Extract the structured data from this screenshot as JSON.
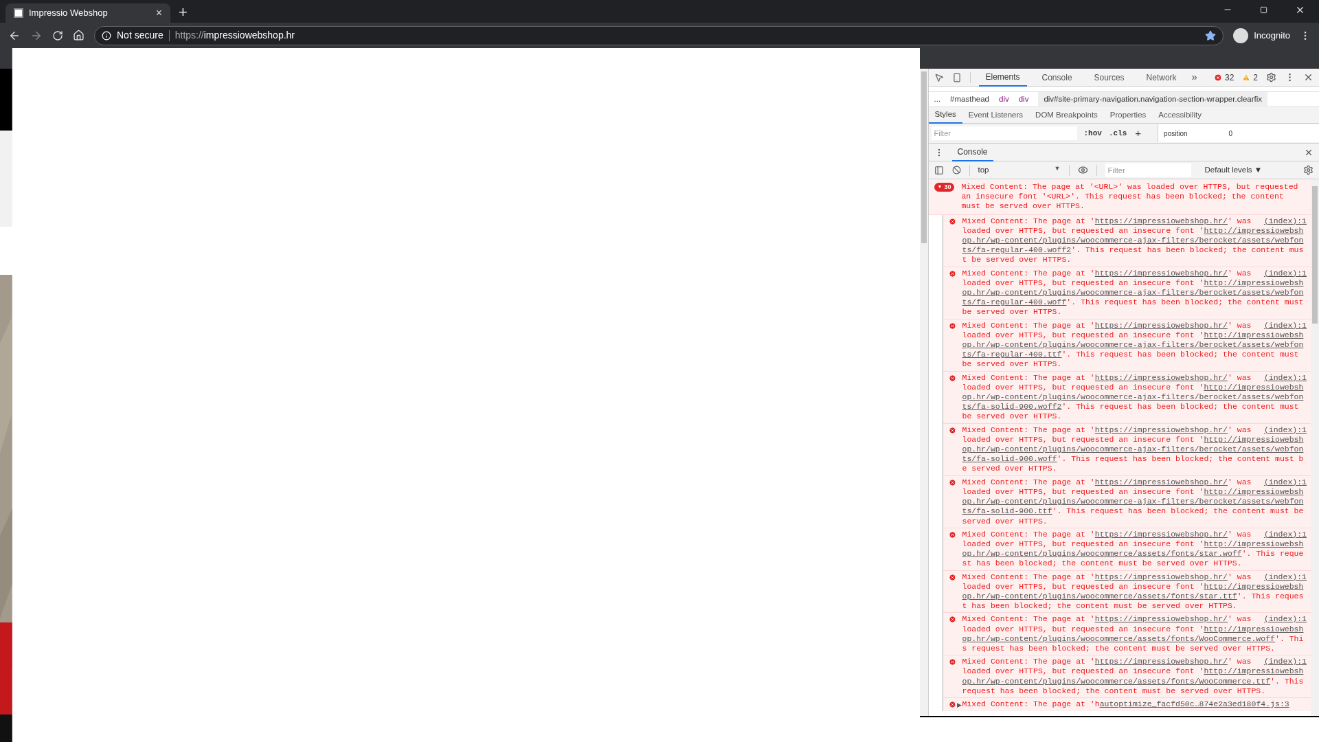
{
  "browser": {
    "tab": {
      "title": "Impressio Webshop",
      "close": "×",
      "new_tab": "+"
    },
    "address": {
      "security": "Not secure",
      "url_scheme": "https://",
      "url_host": "impressiowebshop.hr"
    },
    "profile": "Incognito"
  },
  "devtools": {
    "tabs": [
      {
        "label": "Elements",
        "selected": true
      },
      {
        "label": "Console",
        "selected": false
      },
      {
        "label": "Sources",
        "selected": false
      },
      {
        "label": "Network",
        "selected": false
      }
    ],
    "more": "»",
    "errors": "32",
    "warnings": "2",
    "breadcrumbs": [
      {
        "label": "...",
        "kind": "plain"
      },
      {
        "label": "#masthead",
        "kind": "plain"
      },
      {
        "label": "div",
        "kind": "tag"
      },
      {
        "label": "div",
        "kind": "tag"
      },
      {
        "label": "div#site-primary-navigation.navigation-section-wrapper.clearfix",
        "kind": "current"
      }
    ],
    "subtabs": [
      {
        "label": "Styles",
        "selected": true
      },
      {
        "label": "Event Listeners",
        "selected": false
      },
      {
        "label": "DOM Breakpoints",
        "selected": false
      },
      {
        "label": "Properties",
        "selected": false
      },
      {
        "label": "Accessibility",
        "selected": false
      }
    ],
    "styles_filter": {
      "placeholder": "Filter"
    },
    "hov": ":hov",
    "cls": ".cls",
    "plus": "+",
    "box_model": {
      "label": "position",
      "value": "0"
    },
    "drawer_tab": "Console",
    "context": "top",
    "console_filter": {
      "placeholder": "Filter"
    },
    "levels": "Default levels ▼",
    "group": {
      "count": "30",
      "arrow": "▼",
      "text": "Mixed Content: The page at '<URL>' was loaded over HTTPS, but requested an insecure font '<URL>'. This request has been blocked; the content must be served over HTTPS."
    },
    "messages": [
      {
        "head": "Mixed Content: The page at '",
        "page_url": "https://impressiowebshop.hr/",
        "head_end": "' was",
        "source": "(index):1",
        "body": "loaded over HTTPS, but requested an insecure font '",
        "font_url": "http://impressiowebshop.hr/wp-content/plugins/woocommerce-ajax-filters/berocket/assets/webfonts/fa-regular-400.woff2",
        "tail": "'. This request has been blocked; the content must be served over HTTPS."
      },
      {
        "head": "Mixed Content: The page at '",
        "page_url": "https://impressiowebshop.hr/",
        "head_end": "' was",
        "source": "(index):1",
        "body": "loaded over HTTPS, but requested an insecure font '",
        "font_url": "http://impressiowebshop.hr/wp-content/plugins/woocommerce-ajax-filters/berocket/assets/webfonts/fa-regular-400.woff",
        "tail": "'. This request has been blocked; the content must be served over HTTPS."
      },
      {
        "head": "Mixed Content: The page at '",
        "page_url": "https://impressiowebshop.hr/",
        "head_end": "' was",
        "source": "(index):1",
        "body": "loaded over HTTPS, but requested an insecure font '",
        "font_url": "http://impressiowebshop.hr/wp-content/plugins/woocommerce-ajax-filters/berocket/assets/webfonts/fa-regular-400.ttf",
        "tail": "'. This request has been blocked; the content must be served over HTTPS."
      },
      {
        "head": "Mixed Content: The page at '",
        "page_url": "https://impressiowebshop.hr/",
        "head_end": "' was",
        "source": "(index):1",
        "body": "loaded over HTTPS, but requested an insecure font '",
        "font_url": "http://impressiowebshop.hr/wp-content/plugins/woocommerce-ajax-filters/berocket/assets/webfonts/fa-solid-900.woff2",
        "tail": "'. This request has been blocked; the content must be served over HTTPS."
      },
      {
        "head": "Mixed Content: The page at '",
        "page_url": "https://impressiowebshop.hr/",
        "head_end": "' was",
        "source": "(index):1",
        "body": "loaded over HTTPS, but requested an insecure font '",
        "font_url": "http://impressiowebshop.hr/wp-content/plugins/woocommerce-ajax-filters/berocket/assets/webfonts/fa-solid-900.woff",
        "tail": "'. This request has been blocked; the content must be served over HTTPS."
      },
      {
        "head": "Mixed Content: The page at '",
        "page_url": "https://impressiowebshop.hr/",
        "head_end": "' was",
        "source": "(index):1",
        "body": "loaded over HTTPS, but requested an insecure font '",
        "font_url": "http://impressiowebshop.hr/wp-content/plugins/woocommerce-ajax-filters/berocket/assets/webfonts/fa-solid-900.ttf",
        "tail": "'. This request has been blocked; the content must be served over HTTPS."
      },
      {
        "head": "Mixed Content: The page at '",
        "page_url": "https://impressiowebshop.hr/",
        "head_end": "' was",
        "source": "(index):1",
        "body": "loaded over HTTPS, but requested an insecure font '",
        "font_url": "http://impressiowebshop.hr/wp-content/plugins/woocommerce/assets/fonts/star.woff",
        "tail": "'. This request has been blocked; the content must be served over HTTPS."
      },
      {
        "head": "Mixed Content: The page at '",
        "page_url": "https://impressiowebshop.hr/",
        "head_end": "' was",
        "source": "(index):1",
        "body": "loaded over HTTPS, but requested an insecure font '",
        "font_url": "http://impressiowebshop.hr/wp-content/plugins/woocommerce/assets/fonts/star.ttf",
        "tail": "'. This request has been blocked; the content must be served over HTTPS."
      },
      {
        "head": "Mixed Content: The page at '",
        "page_url": "https://impressiowebshop.hr/",
        "head_end": "' was",
        "source": "(index):1",
        "body": "loaded over HTTPS, but requested an insecure font '",
        "font_url": "http://impressiowebshop.hr/wp-content/plugins/woocommerce/assets/fonts/WooCommerce.woff",
        "tail": "'. This request has been blocked; the content must be served over HTTPS."
      },
      {
        "head": "Mixed Content: The page at '",
        "page_url": "https://impressiowebshop.hr/",
        "head_end": "' was",
        "source": "(index):1",
        "body": "loaded over HTTPS, but requested an insecure font '",
        "font_url": "http://impressiowebshop.hr/wp-content/plugins/woocommerce/assets/fonts/WooCommerce.ttf",
        "tail": "'. This request has been blocked; the content must be served over HTTPS."
      }
    ],
    "last": {
      "arrow": "▶",
      "text": "Mixed Content: The page at 'h",
      "source": "autoptimize_facfd50c…874e2a3ed180f4.js:3"
    }
  }
}
